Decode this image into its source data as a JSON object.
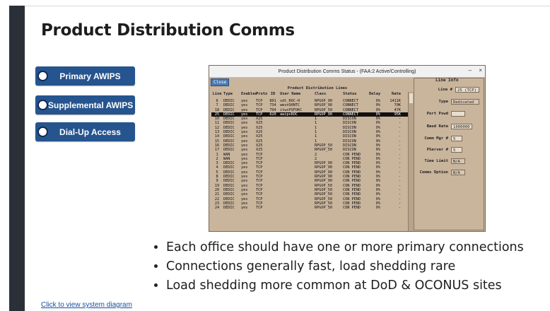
{
  "slide": {
    "title": "Product Distribution Comms",
    "footer_link": "Click to view system diagram"
  },
  "nav_buttons": [
    {
      "label": "Primary AWIPS"
    },
    {
      "label": "Supplemental AWIPS"
    },
    {
      "label": "Dial-Up Access"
    }
  ],
  "window": {
    "title": "Product Distribution Comms Status - (FAA:2 Active/Controlling)",
    "controls": [
      "–",
      "×"
    ],
    "close_button": "Close",
    "table_caption": "Product Distribution Lines",
    "columns": [
      "Line",
      "Type",
      "Enabled",
      "Proto",
      "ID",
      "User Name",
      "Class",
      "Status",
      "Delay",
      "Rate"
    ],
    "rows": [
      [
        "6",
        "DEDIC",
        "yes",
        "TCP",
        "891",
        "sdt_ROC-H",
        "RPGOP_90",
        "CONNECT",
        "0%",
        "1411K"
      ],
      [
        "7",
        "DEDIC",
        "yes",
        "TCP",
        "734",
        "wmsn90NTC",
        "RPGOP_90",
        "CONNECT",
        "0%",
        "70K"
      ],
      [
        "18",
        "DEDIC",
        "yes",
        "TCP",
        "794",
        "itwsPSFOKC",
        "RPGOP_50",
        "CONNECT",
        "0%",
        "47K"
      ],
      [
        "25",
        "DEDIC",
        "yes",
        "TCP",
        "620",
        "awipsROC",
        "RPGOP_90",
        "CONNECT",
        "0%",
        "95K"
      ],
      [
        "10",
        "DEDIC",
        "yes",
        "X25",
        "",
        "",
        "1",
        "DISCON",
        "0%",
        "-"
      ],
      [
        "11",
        "DEDIC",
        "yes",
        "X25",
        "",
        "",
        "1",
        "DISCON",
        "0%",
        "-"
      ],
      [
        "12",
        "DEDIC",
        "yes",
        "X25",
        "",
        "",
        "1",
        "DISCON",
        "0%",
        "-"
      ],
      [
        "13",
        "DEDIC",
        "yes",
        "X25",
        "",
        "",
        "1",
        "DISCON",
        "0%",
        "-"
      ],
      [
        "14",
        "DEDIC",
        "yes",
        "X25",
        "",
        "",
        "1",
        "DISCON",
        "0%",
        "-"
      ],
      [
        "15",
        "DEDIC",
        "yes",
        "X25",
        "",
        "",
        "1",
        "DISCON",
        "0%",
        "-"
      ],
      [
        "16",
        "DEDIC",
        "yes",
        "X25",
        "",
        "",
        "RPGOP_50",
        "DISCON",
        "0%",
        "-"
      ],
      [
        "17",
        "DEDIC",
        "yes",
        "X25",
        "",
        "",
        "RPGOP_50",
        "DISCON",
        "0%",
        "-"
      ],
      [
        "1",
        "WAN",
        "yes",
        "TCP",
        "",
        "",
        "2",
        "CON PEND",
        "0%",
        "-"
      ],
      [
        "2",
        "WAN",
        "yes",
        "TCP",
        "",
        "",
        "2",
        "CON PEND",
        "0%",
        "-"
      ],
      [
        "3",
        "DEDIC",
        "yes",
        "TCP",
        "",
        "",
        "RPGOP_90",
        "CON PEND",
        "0%",
        "-"
      ],
      [
        "4",
        "DEDIC",
        "yes",
        "TCP",
        "",
        "",
        "RPGOP_90",
        "CON PEND",
        "0%",
        "-"
      ],
      [
        "5",
        "DEDIC",
        "yes",
        "TCP",
        "",
        "",
        "RPGOP_90",
        "CON PEND",
        "0%",
        "-"
      ],
      [
        "8",
        "DEDIC",
        "yes",
        "TCP",
        "",
        "",
        "RPGOP_90",
        "CON PEND",
        "0%",
        "-"
      ],
      [
        "9",
        "DEDIC",
        "yes",
        "TCP",
        "",
        "",
        "RPGOP_90",
        "CON PEND",
        "0%",
        "-"
      ],
      [
        "19",
        "DEDIC",
        "yes",
        "TCP",
        "",
        "",
        "RPGOP_50",
        "CON PEND",
        "0%",
        "-"
      ],
      [
        "20",
        "DEDIC",
        "yes",
        "TCP",
        "",
        "",
        "RPGOP_50",
        "CON PEND",
        "0%",
        "-"
      ],
      [
        "21",
        "DEDIC",
        "yes",
        "TCP",
        "",
        "",
        "RPGOP_50",
        "CON PEND",
        "0%",
        "-"
      ],
      [
        "22",
        "DEDIC",
        "yes",
        "TCP",
        "",
        "",
        "RPGOP_50",
        "CON PEND",
        "0%",
        "-"
      ],
      [
        "23",
        "DEDIC",
        "yes",
        "TCP",
        "",
        "",
        "RPGOP_50",
        "CON PEND",
        "0%",
        "-"
      ],
      [
        "24",
        "DEDIC",
        "yes",
        "TCP",
        "",
        "",
        "RPGOP_50",
        "CON PEND",
        "0%",
        "-"
      ]
    ],
    "selected_line": "25",
    "line_info": {
      "title": "Line Info",
      "line_label": "Line #",
      "line_value": "25 (TCP)",
      "type_label": "Type",
      "type_value": "Dedicated",
      "port_pswd_label": "Port Pswd",
      "port_pswd_value": "",
      "baud_label": "Baud Rate",
      "baud_value": "1000000",
      "comm_mgr_label": "Comm Mgr #",
      "comm_mgr_value": "5",
      "pserver_label": "PServer #",
      "pserver_value": "5",
      "time_limit_label": "Time Limit",
      "time_limit_value": "N/A",
      "comms_option_label": "Comms Option",
      "comms_option_value": "N/A"
    }
  },
  "bullets": [
    "Each office should have one or more primary connections",
    "Connections generally fast, load shedding rare",
    "Load shedding more common at DoD & OCONUS sites"
  ],
  "colors": {
    "nav_button": "#26548f",
    "left_bar": "#2b2f38",
    "window_bg": "#c9b49c",
    "selected_row": "#111111"
  }
}
